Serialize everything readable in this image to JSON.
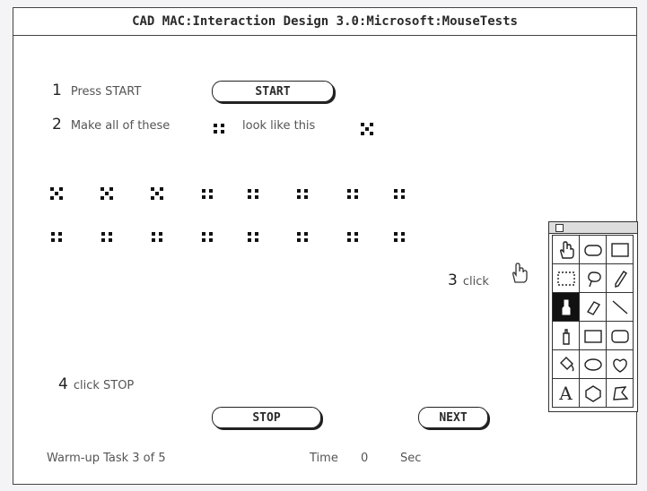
{
  "window": {
    "title": "CAD MAC:Interaction Design 3.0:Microsoft:MouseTests"
  },
  "instructions": {
    "step1_num": "1",
    "step1_text": "Press START",
    "step2_num": "2",
    "step2_text_a": "Make all of these",
    "step2_text_b": "look like this",
    "step3_num": "3",
    "step3_text": "click",
    "step4_num": "4",
    "step4_text": "click STOP"
  },
  "buttons": {
    "start_label": "START",
    "stop_label": "STOP",
    "next_label": "NEXT"
  },
  "dice_grid": {
    "row1": [
      "five",
      "five",
      "five",
      "four",
      "four",
      "four",
      "four",
      "four"
    ],
    "row2": [
      "four",
      "four",
      "four",
      "four",
      "four",
      "four",
      "four",
      "four"
    ]
  },
  "palette": {
    "tools": [
      "hand-tool-icon",
      "rounded-rect-select-icon",
      "rectangle-select-icon",
      "marquee-icon",
      "lasso-icon",
      "pencil-icon",
      "paint-brush-icon",
      "eraser-icon",
      "line-icon",
      "spray-can-icon",
      "rectangle-icon",
      "rounded-rectangle-icon",
      "paint-bucket-icon",
      "oval-icon",
      "freeform-shape-icon",
      "text-tool-icon",
      "polygon-icon",
      "irregular-polygon-icon"
    ],
    "selected_index": 6,
    "text_tool_glyph": "A"
  },
  "footer": {
    "task_label": "Warm-up Task 3 of 5",
    "time_label": "Time",
    "time_value": "0",
    "time_unit": "Sec"
  }
}
